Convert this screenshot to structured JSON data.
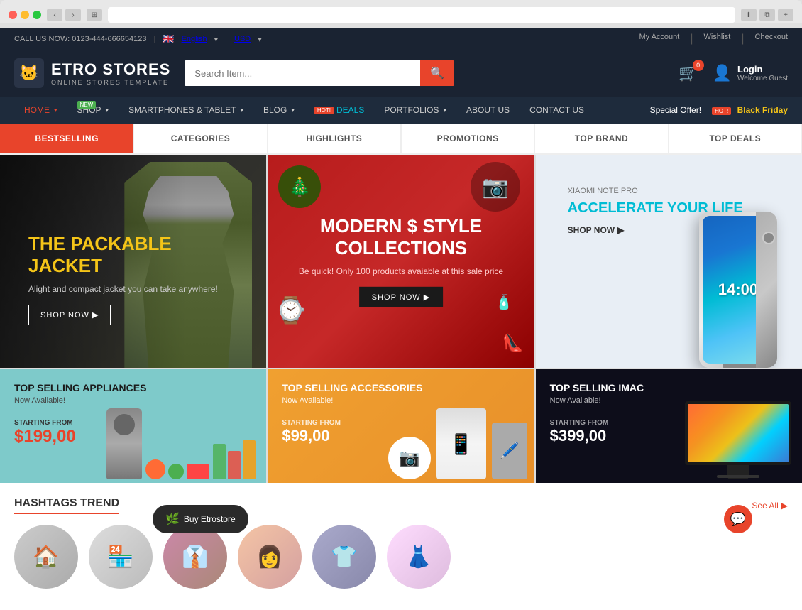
{
  "browser": {
    "url": ""
  },
  "topbar": {
    "phone": "CALL US NOW: 0123-444-666654123",
    "language": "English",
    "currency": "USD",
    "my_account": "My Account",
    "wishlist": "Wishlist",
    "checkout": "Checkout"
  },
  "logo": {
    "name": "ETRO STORES",
    "sub": "ONLINE STORES TEMPLATE"
  },
  "search": {
    "placeholder": "Search Item..."
  },
  "cart": {
    "count": "0"
  },
  "login": {
    "label": "Login",
    "welcome": "Welcome Guest"
  },
  "nav": {
    "items": [
      {
        "label": "HOME",
        "badge": ""
      },
      {
        "label": "SHOP",
        "badge": "NEW"
      },
      {
        "label": "SMARTPHONES & TABLET",
        "badge": ""
      },
      {
        "label": "BLOG",
        "badge": ""
      },
      {
        "label": "DEALS",
        "badge": "HOT!"
      },
      {
        "label": "PORTFOLIOS",
        "badge": ""
      },
      {
        "label": "ABOUT US",
        "badge": ""
      },
      {
        "label": "CONTACT US",
        "badge": ""
      }
    ],
    "special_offer": "Special Offer!",
    "black_friday": "Black Friday",
    "hot_label": "HOT!"
  },
  "tabs": [
    {
      "label": "BESTSELLING",
      "active": true
    },
    {
      "label": "CATEGORIES",
      "active": false
    },
    {
      "label": "HIGHLIGHTS",
      "active": false
    },
    {
      "label": "PROMOTIONS",
      "active": false
    },
    {
      "label": "TOP BRAND",
      "active": false
    },
    {
      "label": "TOP DEALS",
      "active": false
    }
  ],
  "banner1": {
    "title": "THE PACKABLE JACKET",
    "sub": "Alight and compact jacket you can take anywhere!",
    "cta": "SHOP NOW"
  },
  "banner2": {
    "title": "MODERN $ STYLE COLLECTIONS",
    "sub": "Be quick! Only 100 products avaiable at this sale price",
    "cta": "SHOP NOW"
  },
  "banner3": {
    "small": "XIAOMI NOTE PRO",
    "title": "ACCELERATE YOUR LIFE",
    "cta": "SHOP NOW"
  },
  "bottom_banners": [
    {
      "title": "TOP SELLING APPLIANCES",
      "sub": "Now Available!",
      "price_label": "STARTING FROM",
      "price": "$199,00"
    },
    {
      "title": "TOP SELLING ACCESSORIES",
      "sub": "Now Available!",
      "price_label": "STARTING FROM",
      "price": "$99,00"
    },
    {
      "title": "TOP SELLING IMAC",
      "sub": "Now Available!",
      "price_label": "STARTING FROM",
      "price": "$399,00"
    }
  ],
  "hashtags": {
    "title": "HASHTAGS TREND",
    "see_all": "See All"
  },
  "buy_btn": {
    "label": "Buy Etrostore"
  },
  "colors": {
    "primary": "#e8442b",
    "dark_bg": "#1a2332",
    "nav_bg": "#1e2b3c",
    "accent_cyan": "#00bcd4",
    "yellow": "#f5c518"
  }
}
